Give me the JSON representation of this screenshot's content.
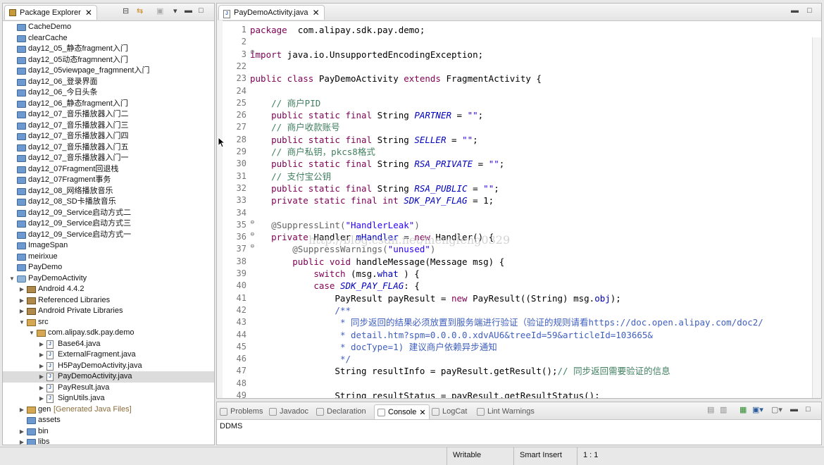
{
  "explorer": {
    "title": "Package Explorer",
    "items": [
      {
        "label": "CacheDemo",
        "depth": 0,
        "icon": "folder"
      },
      {
        "label": "clearCache",
        "depth": 0,
        "icon": "folder"
      },
      {
        "label": "day12_05_静态fragment入门",
        "depth": 0,
        "icon": "folder"
      },
      {
        "label": "day12_05动态fragmnent入门",
        "depth": 0,
        "icon": "folder"
      },
      {
        "label": "day12_05viewpage_fragmnent入门",
        "depth": 0,
        "icon": "folder"
      },
      {
        "label": "day12_06_登录界面",
        "depth": 0,
        "icon": "folder"
      },
      {
        "label": "day12_06_今日头条",
        "depth": 0,
        "icon": "folder"
      },
      {
        "label": "day12_06_静态fragment入门",
        "depth": 0,
        "icon": "folder"
      },
      {
        "label": "day12_07_音乐播放器入门二",
        "depth": 0,
        "icon": "folder"
      },
      {
        "label": "day12_07_音乐播放器入门三",
        "depth": 0,
        "icon": "folder"
      },
      {
        "label": "day12_07_音乐播放器入门四",
        "depth": 0,
        "icon": "folder"
      },
      {
        "label": "day12_07_音乐播放器入门五",
        "depth": 0,
        "icon": "folder"
      },
      {
        "label": "day12_07_音乐播放器入门一",
        "depth": 0,
        "icon": "folder"
      },
      {
        "label": "day12_07Fragment回退栈",
        "depth": 0,
        "icon": "folder"
      },
      {
        "label": "day12_07Fragment事务",
        "depth": 0,
        "icon": "folder"
      },
      {
        "label": "day12_08_网络播放音乐",
        "depth": 0,
        "icon": "folder"
      },
      {
        "label": "day12_08_SD卡播放音乐",
        "depth": 0,
        "icon": "folder"
      },
      {
        "label": "day12_09_Service启动方式二",
        "depth": 0,
        "icon": "folder"
      },
      {
        "label": "day12_09_Service启动方式三",
        "depth": 0,
        "icon": "folder"
      },
      {
        "label": "day12_09_Service启动方式一",
        "depth": 0,
        "icon": "folder"
      },
      {
        "label": "ImageSpan",
        "depth": 0,
        "icon": "folder"
      },
      {
        "label": "meirixue",
        "depth": 0,
        "icon": "folder"
      },
      {
        "label": "PayDemo",
        "depth": 0,
        "icon": "folder"
      },
      {
        "label": "PayDemoActivity",
        "depth": 0,
        "icon": "project",
        "arrow": "down"
      },
      {
        "label": "Android 4.4.2",
        "depth": 1,
        "icon": "lib",
        "arrow": "right"
      },
      {
        "label": "Referenced Libraries",
        "depth": 1,
        "icon": "lib",
        "arrow": "right"
      },
      {
        "label": "Android Private Libraries",
        "depth": 1,
        "icon": "lib",
        "arrow": "right"
      },
      {
        "label": "src",
        "depth": 1,
        "icon": "pkg",
        "arrow": "down"
      },
      {
        "label": "com.alipay.sdk.pay.demo",
        "depth": 2,
        "icon": "pkg",
        "arrow": "down"
      },
      {
        "label": "Base64.java",
        "depth": 3,
        "icon": "java",
        "arrow": "right"
      },
      {
        "label": "ExternalFragment.java",
        "depth": 3,
        "icon": "java",
        "arrow": "right"
      },
      {
        "label": "H5PayDemoActivity.java",
        "depth": 3,
        "icon": "java",
        "arrow": "right"
      },
      {
        "label": "PayDemoActivity.java",
        "depth": 3,
        "icon": "java",
        "arrow": "right",
        "selected": true
      },
      {
        "label": "PayResult.java",
        "depth": 3,
        "icon": "java",
        "arrow": "right"
      },
      {
        "label": "SignUtils.java",
        "depth": 3,
        "icon": "java",
        "arrow": "right"
      },
      {
        "label": "gen",
        "suffix": " [Generated Java Files]",
        "depth": 1,
        "icon": "pkg",
        "arrow": "right"
      },
      {
        "label": "assets",
        "depth": 1,
        "icon": "folder"
      },
      {
        "label": "bin",
        "depth": 1,
        "icon": "folder",
        "arrow": "right"
      },
      {
        "label": "libs",
        "depth": 1,
        "icon": "folder",
        "arrow": "right"
      }
    ]
  },
  "editor": {
    "tab_label": "PayDemoActivity.java",
    "watermark": "http://blog.csdn.net/mengfeng0329",
    "lines": [
      {
        "n": "1",
        "tokens": [
          [
            "kw",
            "package"
          ],
          [
            "",
            "  com.alipay.sdk.pay.demo;"
          ]
        ]
      },
      {
        "n": "2",
        "tokens": []
      },
      {
        "n": "3",
        "fold": "⊕",
        "tokens": [
          [
            "kw",
            "import"
          ],
          [
            "",
            " java.io.UnsupportedEncodingException;"
          ]
        ]
      },
      {
        "n": "22",
        "tokens": []
      },
      {
        "n": "23",
        "tokens": [
          [
            "kw",
            "public class"
          ],
          [
            "",
            " PayDemoActivity "
          ],
          [
            "kw",
            "extends"
          ],
          [
            "",
            " FragmentActivity {"
          ]
        ]
      },
      {
        "n": "24",
        "tokens": []
      },
      {
        "n": "25",
        "tokens": [
          [
            "",
            "    "
          ],
          [
            "cm",
            "// 商户PID"
          ]
        ]
      },
      {
        "n": "26",
        "tokens": [
          [
            "",
            "    "
          ],
          [
            "kw",
            "public static final"
          ],
          [
            "",
            " String "
          ],
          [
            "fi",
            "PARTNER"
          ],
          [
            "",
            " = "
          ],
          [
            "st",
            "\"\""
          ],
          [
            "",
            ";"
          ]
        ]
      },
      {
        "n": "27",
        "tokens": [
          [
            "",
            "    "
          ],
          [
            "cm",
            "// 商户收款账号"
          ]
        ]
      },
      {
        "n": "28",
        "tokens": [
          [
            "",
            "    "
          ],
          [
            "kw",
            "public static final"
          ],
          [
            "",
            " String "
          ],
          [
            "fi",
            "SELLER"
          ],
          [
            "",
            " = "
          ],
          [
            "st",
            "\"\""
          ],
          [
            "",
            ";"
          ]
        ]
      },
      {
        "n": "29",
        "tokens": [
          [
            "",
            "    "
          ],
          [
            "cm",
            "// 商户私钥，pkcs8格式"
          ]
        ]
      },
      {
        "n": "30",
        "tokens": [
          [
            "",
            "    "
          ],
          [
            "kw",
            "public static final"
          ],
          [
            "",
            " String "
          ],
          [
            "fi",
            "RSA_PRIVATE"
          ],
          [
            "",
            " = "
          ],
          [
            "st",
            "\"\""
          ],
          [
            "",
            ";"
          ]
        ]
      },
      {
        "n": "31",
        "tokens": [
          [
            "",
            "    "
          ],
          [
            "cm",
            "// 支付宝公钥"
          ]
        ]
      },
      {
        "n": "32",
        "tokens": [
          [
            "",
            "    "
          ],
          [
            "kw",
            "public static final"
          ],
          [
            "",
            " String "
          ],
          [
            "fi",
            "RSA_PUBLIC"
          ],
          [
            "",
            " = "
          ],
          [
            "st",
            "\"\""
          ],
          [
            "",
            ";"
          ]
        ]
      },
      {
        "n": "33",
        "tokens": [
          [
            "",
            "    "
          ],
          [
            "kw",
            "private static final int"
          ],
          [
            "",
            " "
          ],
          [
            "fi",
            "SDK_PAY_FLAG"
          ],
          [
            "",
            " = 1;"
          ]
        ]
      },
      {
        "n": "34",
        "tokens": []
      },
      {
        "n": "35",
        "fold": "⊖",
        "tokens": [
          [
            "",
            "    "
          ],
          [
            "an",
            "@SuppressLint("
          ],
          [
            "st",
            "\"HandlerLeak\""
          ],
          [
            "an",
            ")"
          ]
        ]
      },
      {
        "n": "36",
        "fold": "⊖",
        "tokens": [
          [
            "",
            "    "
          ],
          [
            "kw",
            "private"
          ],
          [
            "",
            " Handler "
          ],
          [
            "fn",
            "mHandler"
          ],
          [
            "",
            " = "
          ],
          [
            "kw",
            "new"
          ],
          [
            "",
            " Handler() {"
          ]
        ]
      },
      {
        "n": "37",
        "fold": "⊖",
        "tokens": [
          [
            "",
            "        "
          ],
          [
            "an",
            "@SuppressWarnings("
          ],
          [
            "st",
            "\"unused\""
          ],
          [
            "an",
            ")"
          ]
        ]
      },
      {
        "n": "38",
        "tokens": [
          [
            "",
            "        "
          ],
          [
            "kw",
            "public void"
          ],
          [
            "",
            " handleMessage(Message msg) {"
          ]
        ]
      },
      {
        "n": "39",
        "tokens": [
          [
            "",
            "            "
          ],
          [
            "kw",
            "switch"
          ],
          [
            "",
            " (msg."
          ],
          [
            "fn",
            "what"
          ],
          [
            "",
            " ) {"
          ]
        ]
      },
      {
        "n": "40",
        "tokens": [
          [
            "",
            "            "
          ],
          [
            "kw",
            "case"
          ],
          [
            "",
            " "
          ],
          [
            "fi",
            "SDK_PAY_FLAG"
          ],
          [
            "",
            ": {"
          ]
        ]
      },
      {
        "n": "41",
        "tokens": [
          [
            "",
            "                PayResult payResult = "
          ],
          [
            "kw",
            "new"
          ],
          [
            "",
            " PayResult((String) msg."
          ],
          [
            "fn",
            "obj"
          ],
          [
            "",
            ");"
          ]
        ]
      },
      {
        "n": "42",
        "tokens": [
          [
            "",
            "                "
          ],
          [
            "jd",
            "/**"
          ]
        ]
      },
      {
        "n": "43",
        "tokens": [
          [
            "",
            "                 "
          ],
          [
            "jd",
            "* 同步返回的结果必须放置到服务端进行验证（验证的规则请看https://doc.open.alipay.com/doc2/"
          ]
        ]
      },
      {
        "n": "44",
        "tokens": [
          [
            "",
            "                 "
          ],
          [
            "jd",
            "* detail.htm?spm=0.0.0.0.xdvAU6&treeId=59&articleId=103665&"
          ]
        ]
      },
      {
        "n": "45",
        "tokens": [
          [
            "",
            "                 "
          ],
          [
            "jd",
            "* docType=1) 建议商户依赖异步通知"
          ]
        ]
      },
      {
        "n": "46",
        "tokens": [
          [
            "",
            "                 "
          ],
          [
            "jd",
            "*/"
          ]
        ]
      },
      {
        "n": "47",
        "tokens": [
          [
            "",
            "                String resultInfo = payResult.getResult();"
          ],
          [
            "cm",
            "// 同步返回需要验证的信息"
          ]
        ]
      },
      {
        "n": "48",
        "tokens": []
      },
      {
        "n": "49",
        "tokens": [
          [
            "",
            "                String resultStatus = payResult.getResultStatus();"
          ]
        ]
      }
    ]
  },
  "console": {
    "tabs": [
      {
        "label": "Problems",
        "active": false
      },
      {
        "label": "Javadoc",
        "active": false
      },
      {
        "label": "Declaration",
        "active": false
      },
      {
        "label": "Console",
        "active": true
      },
      {
        "label": "LogCat",
        "active": false
      },
      {
        "label": "Lint Warnings",
        "active": false
      }
    ],
    "content": "DDMS"
  },
  "status": {
    "writable": "Writable",
    "insert_mode": "Smart Insert",
    "position": "1 : 1"
  }
}
